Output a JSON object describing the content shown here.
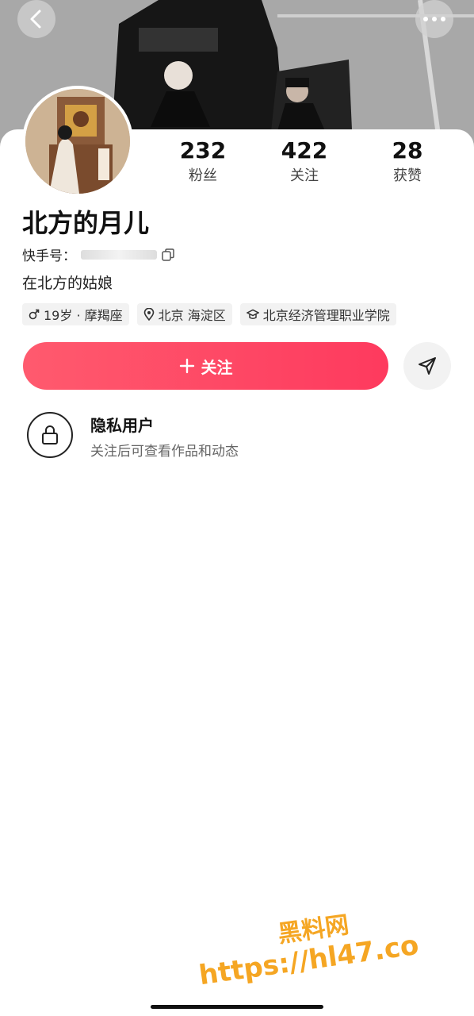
{
  "header": {
    "back_icon": "chevron-left-icon",
    "more_icon": "ellipsis-icon"
  },
  "profile": {
    "stats": [
      {
        "value": "232",
        "label": "粉丝"
      },
      {
        "value": "422",
        "label": "关注"
      },
      {
        "value": "28",
        "label": "获赞"
      }
    ],
    "name": "北方的月儿",
    "id_label": "快手号：",
    "bio": "在北方的姑娘",
    "tags": {
      "age": "19岁 · 摩羯座",
      "location": "北京 海淀区",
      "school": "北京经济管理职业学院"
    }
  },
  "actions": {
    "follow_label": "关注",
    "follow_color": "#fe3a5e"
  },
  "privacy": {
    "title": "隐私用户",
    "subtitle": "关注后可查看作品和动态"
  },
  "watermark": {
    "line1": "黑料网",
    "line2": "https://hl47.co",
    "color": "#f5a623"
  }
}
